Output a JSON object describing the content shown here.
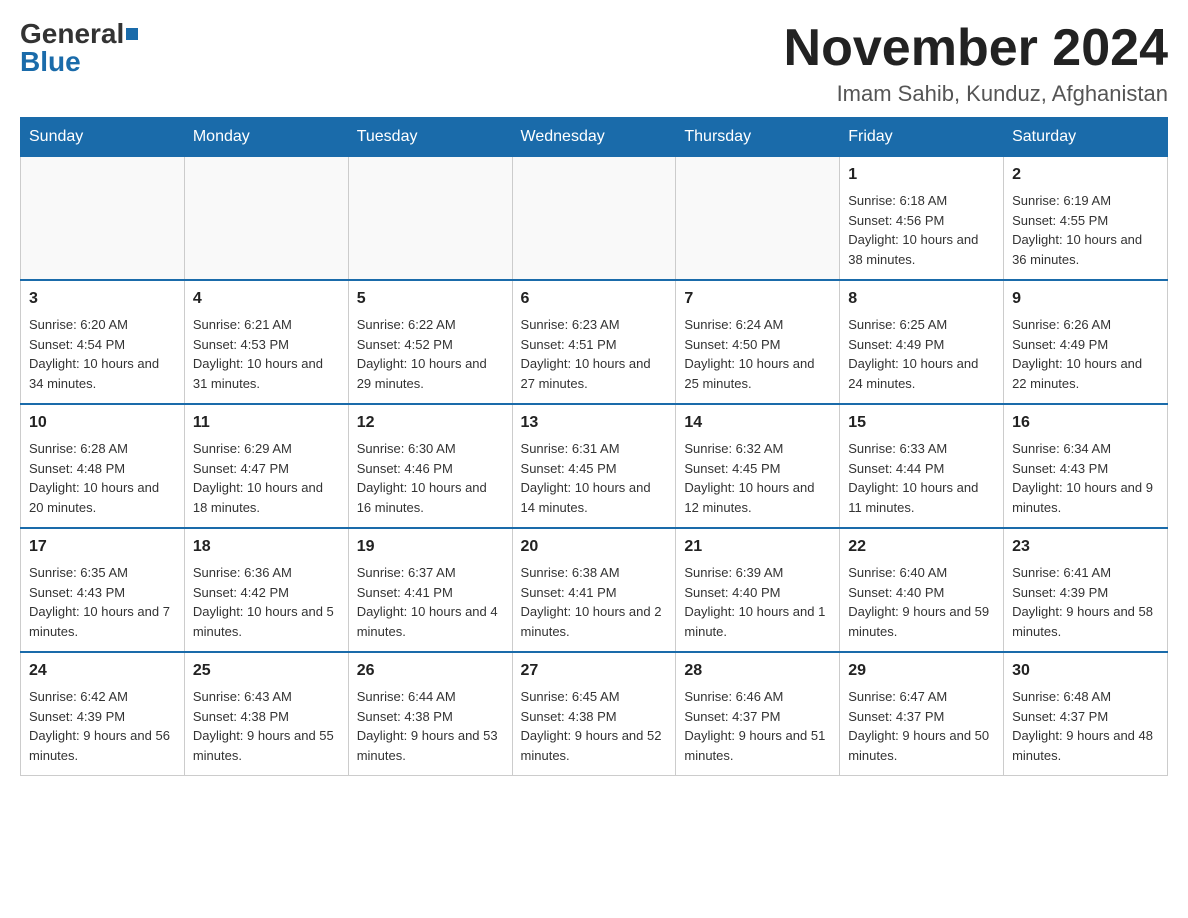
{
  "logo": {
    "general": "General",
    "blue": "Blue"
  },
  "title": {
    "month_year": "November 2024",
    "location": "Imam Sahib, Kunduz, Afghanistan"
  },
  "weekdays": [
    "Sunday",
    "Monday",
    "Tuesday",
    "Wednesday",
    "Thursday",
    "Friday",
    "Saturday"
  ],
  "weeks": [
    [
      {
        "day": "",
        "info": ""
      },
      {
        "day": "",
        "info": ""
      },
      {
        "day": "",
        "info": ""
      },
      {
        "day": "",
        "info": ""
      },
      {
        "day": "",
        "info": ""
      },
      {
        "day": "1",
        "info": "Sunrise: 6:18 AM\nSunset: 4:56 PM\nDaylight: 10 hours and 38 minutes."
      },
      {
        "day": "2",
        "info": "Sunrise: 6:19 AM\nSunset: 4:55 PM\nDaylight: 10 hours and 36 minutes."
      }
    ],
    [
      {
        "day": "3",
        "info": "Sunrise: 6:20 AM\nSunset: 4:54 PM\nDaylight: 10 hours and 34 minutes."
      },
      {
        "day": "4",
        "info": "Sunrise: 6:21 AM\nSunset: 4:53 PM\nDaylight: 10 hours and 31 minutes."
      },
      {
        "day": "5",
        "info": "Sunrise: 6:22 AM\nSunset: 4:52 PM\nDaylight: 10 hours and 29 minutes."
      },
      {
        "day": "6",
        "info": "Sunrise: 6:23 AM\nSunset: 4:51 PM\nDaylight: 10 hours and 27 minutes."
      },
      {
        "day": "7",
        "info": "Sunrise: 6:24 AM\nSunset: 4:50 PM\nDaylight: 10 hours and 25 minutes."
      },
      {
        "day": "8",
        "info": "Sunrise: 6:25 AM\nSunset: 4:49 PM\nDaylight: 10 hours and 24 minutes."
      },
      {
        "day": "9",
        "info": "Sunrise: 6:26 AM\nSunset: 4:49 PM\nDaylight: 10 hours and 22 minutes."
      }
    ],
    [
      {
        "day": "10",
        "info": "Sunrise: 6:28 AM\nSunset: 4:48 PM\nDaylight: 10 hours and 20 minutes."
      },
      {
        "day": "11",
        "info": "Sunrise: 6:29 AM\nSunset: 4:47 PM\nDaylight: 10 hours and 18 minutes."
      },
      {
        "day": "12",
        "info": "Sunrise: 6:30 AM\nSunset: 4:46 PM\nDaylight: 10 hours and 16 minutes."
      },
      {
        "day": "13",
        "info": "Sunrise: 6:31 AM\nSunset: 4:45 PM\nDaylight: 10 hours and 14 minutes."
      },
      {
        "day": "14",
        "info": "Sunrise: 6:32 AM\nSunset: 4:45 PM\nDaylight: 10 hours and 12 minutes."
      },
      {
        "day": "15",
        "info": "Sunrise: 6:33 AM\nSunset: 4:44 PM\nDaylight: 10 hours and 11 minutes."
      },
      {
        "day": "16",
        "info": "Sunrise: 6:34 AM\nSunset: 4:43 PM\nDaylight: 10 hours and 9 minutes."
      }
    ],
    [
      {
        "day": "17",
        "info": "Sunrise: 6:35 AM\nSunset: 4:43 PM\nDaylight: 10 hours and 7 minutes."
      },
      {
        "day": "18",
        "info": "Sunrise: 6:36 AM\nSunset: 4:42 PM\nDaylight: 10 hours and 5 minutes."
      },
      {
        "day": "19",
        "info": "Sunrise: 6:37 AM\nSunset: 4:41 PM\nDaylight: 10 hours and 4 minutes."
      },
      {
        "day": "20",
        "info": "Sunrise: 6:38 AM\nSunset: 4:41 PM\nDaylight: 10 hours and 2 minutes."
      },
      {
        "day": "21",
        "info": "Sunrise: 6:39 AM\nSunset: 4:40 PM\nDaylight: 10 hours and 1 minute."
      },
      {
        "day": "22",
        "info": "Sunrise: 6:40 AM\nSunset: 4:40 PM\nDaylight: 9 hours and 59 minutes."
      },
      {
        "day": "23",
        "info": "Sunrise: 6:41 AM\nSunset: 4:39 PM\nDaylight: 9 hours and 58 minutes."
      }
    ],
    [
      {
        "day": "24",
        "info": "Sunrise: 6:42 AM\nSunset: 4:39 PM\nDaylight: 9 hours and 56 minutes."
      },
      {
        "day": "25",
        "info": "Sunrise: 6:43 AM\nSunset: 4:38 PM\nDaylight: 9 hours and 55 minutes."
      },
      {
        "day": "26",
        "info": "Sunrise: 6:44 AM\nSunset: 4:38 PM\nDaylight: 9 hours and 53 minutes."
      },
      {
        "day": "27",
        "info": "Sunrise: 6:45 AM\nSunset: 4:38 PM\nDaylight: 9 hours and 52 minutes."
      },
      {
        "day": "28",
        "info": "Sunrise: 6:46 AM\nSunset: 4:37 PM\nDaylight: 9 hours and 51 minutes."
      },
      {
        "day": "29",
        "info": "Sunrise: 6:47 AM\nSunset: 4:37 PM\nDaylight: 9 hours and 50 minutes."
      },
      {
        "day": "30",
        "info": "Sunrise: 6:48 AM\nSunset: 4:37 PM\nDaylight: 9 hours and 48 minutes."
      }
    ]
  ]
}
